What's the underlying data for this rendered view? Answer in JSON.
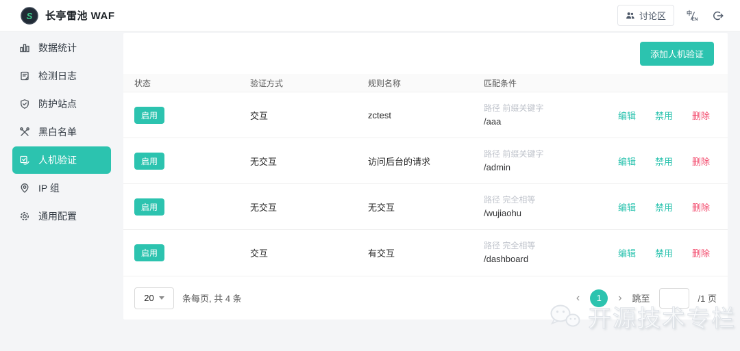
{
  "topbar": {
    "title": "长亭雷池 WAF",
    "discussion_label": "讨论区"
  },
  "sidebar": {
    "items": [
      {
        "label": "数据统计",
        "icon": "bar-chart-icon",
        "active": false
      },
      {
        "label": "检测日志",
        "icon": "log-icon",
        "active": false
      },
      {
        "label": "防护站点",
        "icon": "shield-icon",
        "active": false
      },
      {
        "label": "黑白名单",
        "icon": "tools-icon",
        "active": false
      },
      {
        "label": "人机验证",
        "icon": "captcha-icon",
        "active": true
      },
      {
        "label": "IP 组",
        "icon": "pin-icon",
        "active": false
      },
      {
        "label": "通用配置",
        "icon": "gear-icon",
        "active": false
      }
    ]
  },
  "main": {
    "add_button": "添加人机验证",
    "table": {
      "headers": [
        "状态",
        "验证方式",
        "规则名称",
        "匹配条件"
      ],
      "actions": {
        "edit": "编辑",
        "disable": "禁用",
        "delete": "删除"
      },
      "rows": [
        {
          "status": "启用",
          "method": "交互",
          "name": "zctest",
          "condition_type": "路径 前缀关键字",
          "condition_value": "/aaa"
        },
        {
          "status": "启用",
          "method": "无交互",
          "name": "访问后台的请求",
          "condition_type": "路径 前缀关键字",
          "condition_value": "/admin"
        },
        {
          "status": "启用",
          "method": "无交互",
          "name": "无交互",
          "condition_type": "路径 完全相等",
          "condition_value": "/wujiaohu"
        },
        {
          "status": "启用",
          "method": "交互",
          "name": "有交互",
          "condition_type": "路径 完全相等",
          "condition_value": "/dashboard"
        }
      ]
    },
    "pagination": {
      "page_size": "20",
      "summary": "条每页, 共 4 条",
      "prev": "‹",
      "next": "›",
      "current_page": "1",
      "jump_label": "跳至",
      "total_label": "/1 页"
    }
  },
  "watermark": {
    "text": "开源技术专栏"
  },
  "icons": {
    "logo": "safeline-logo-icon",
    "topbar": [
      "users-icon",
      "language-toggle-icon",
      "logout-icon"
    ],
    "sidebar": [
      "bar-chart-icon",
      "log-icon",
      "shield-icon",
      "tools-icon",
      "captcha-icon",
      "pin-icon",
      "gear-icon"
    ],
    "pagination": [
      "caret-down-icon"
    ],
    "watermark": "wechat-icon"
  },
  "colors": {
    "accent": "#2CC3AF",
    "danger": "#F2476A",
    "page_bg": "#f4f5f7"
  }
}
